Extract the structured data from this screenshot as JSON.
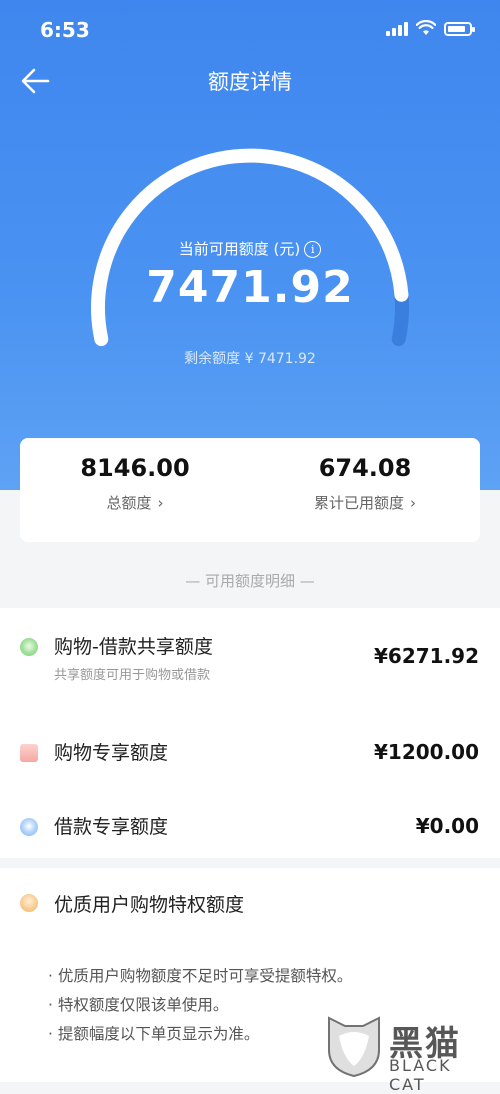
{
  "status_bar": {
    "time": "6:53"
  },
  "nav": {
    "title": "额度详情"
  },
  "gauge": {
    "label": "当前可用额度 (元)",
    "info_glyph": "i",
    "amount": "7471.92",
    "remaining": "剩余额度 ¥ 7471.92",
    "fill_fraction": 0.917
  },
  "summary": {
    "total_value": "8146.00",
    "total_label": "总额度",
    "used_value": "674.08",
    "used_label": "累计已用额度",
    "chevron": "›"
  },
  "section": {
    "title": "— 可用额度明细 —"
  },
  "details": [
    {
      "title": "购物-借款共享额度",
      "subtitle": "共享额度可用于购物或借款",
      "amount": "¥6271.92",
      "icon": "shared-credit-icon",
      "color": "#7ed07e"
    },
    {
      "title": "购物专享额度",
      "subtitle": "",
      "amount": "¥1200.00",
      "icon": "shopping-bag-icon",
      "color": "#f6a7a0"
    },
    {
      "title": "借款专享额度",
      "subtitle": "",
      "amount": "¥0.00",
      "icon": "loan-diamond-icon",
      "color": "#7bb4f2"
    }
  ],
  "premium": {
    "title": "优质用户购物特权额度",
    "icon": "premium-badge-icon",
    "bullets": [
      "· 优质用户购物额度不足时可享受提额特权。",
      "· 特权额度仅限该单使用。",
      "· 提额幅度以下单页显示为准。"
    ]
  },
  "watermark": {
    "text": "黑猫",
    "sub": "BLACK CAT"
  },
  "colors": {
    "primary": "#4a93f2",
    "background": "#f4f5f7"
  }
}
